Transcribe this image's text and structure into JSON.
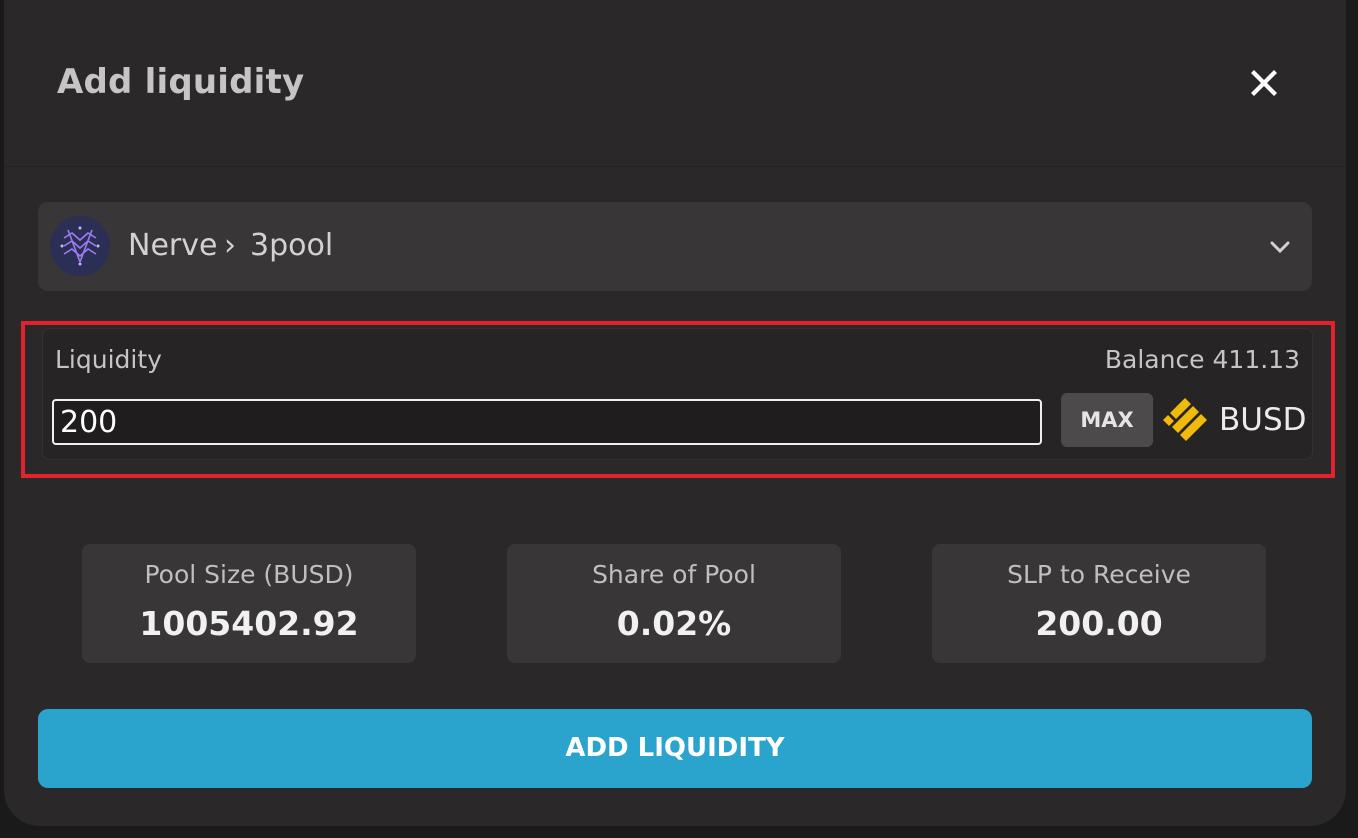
{
  "modal": {
    "title": "Add liquidity"
  },
  "pool_selector": {
    "protocol": "Nerve",
    "separator": "›",
    "pool": "3pool"
  },
  "liquidity": {
    "label": "Liquidity",
    "balance_text": "Balance 411.13",
    "amount_value": "200",
    "max_label": "MAX",
    "token": "BUSD"
  },
  "stats": [
    {
      "label": "Pool Size (BUSD)",
      "value": "1005402.92"
    },
    {
      "label": "Share of Pool",
      "value": "0.02%"
    },
    {
      "label": "SLP to Receive",
      "value": "200.00"
    }
  ],
  "submit_label": "ADD LIQUIDITY",
  "colors": {
    "background": "#2a2829",
    "accent": "#2aa3cd",
    "token_yellow": "#f0b90b",
    "highlight": "#e2222d"
  },
  "icons": {
    "close": "close-icon",
    "pool_logo": "nerve-logo-icon",
    "chevron": "chevron-down-icon",
    "token": "busd-icon"
  }
}
